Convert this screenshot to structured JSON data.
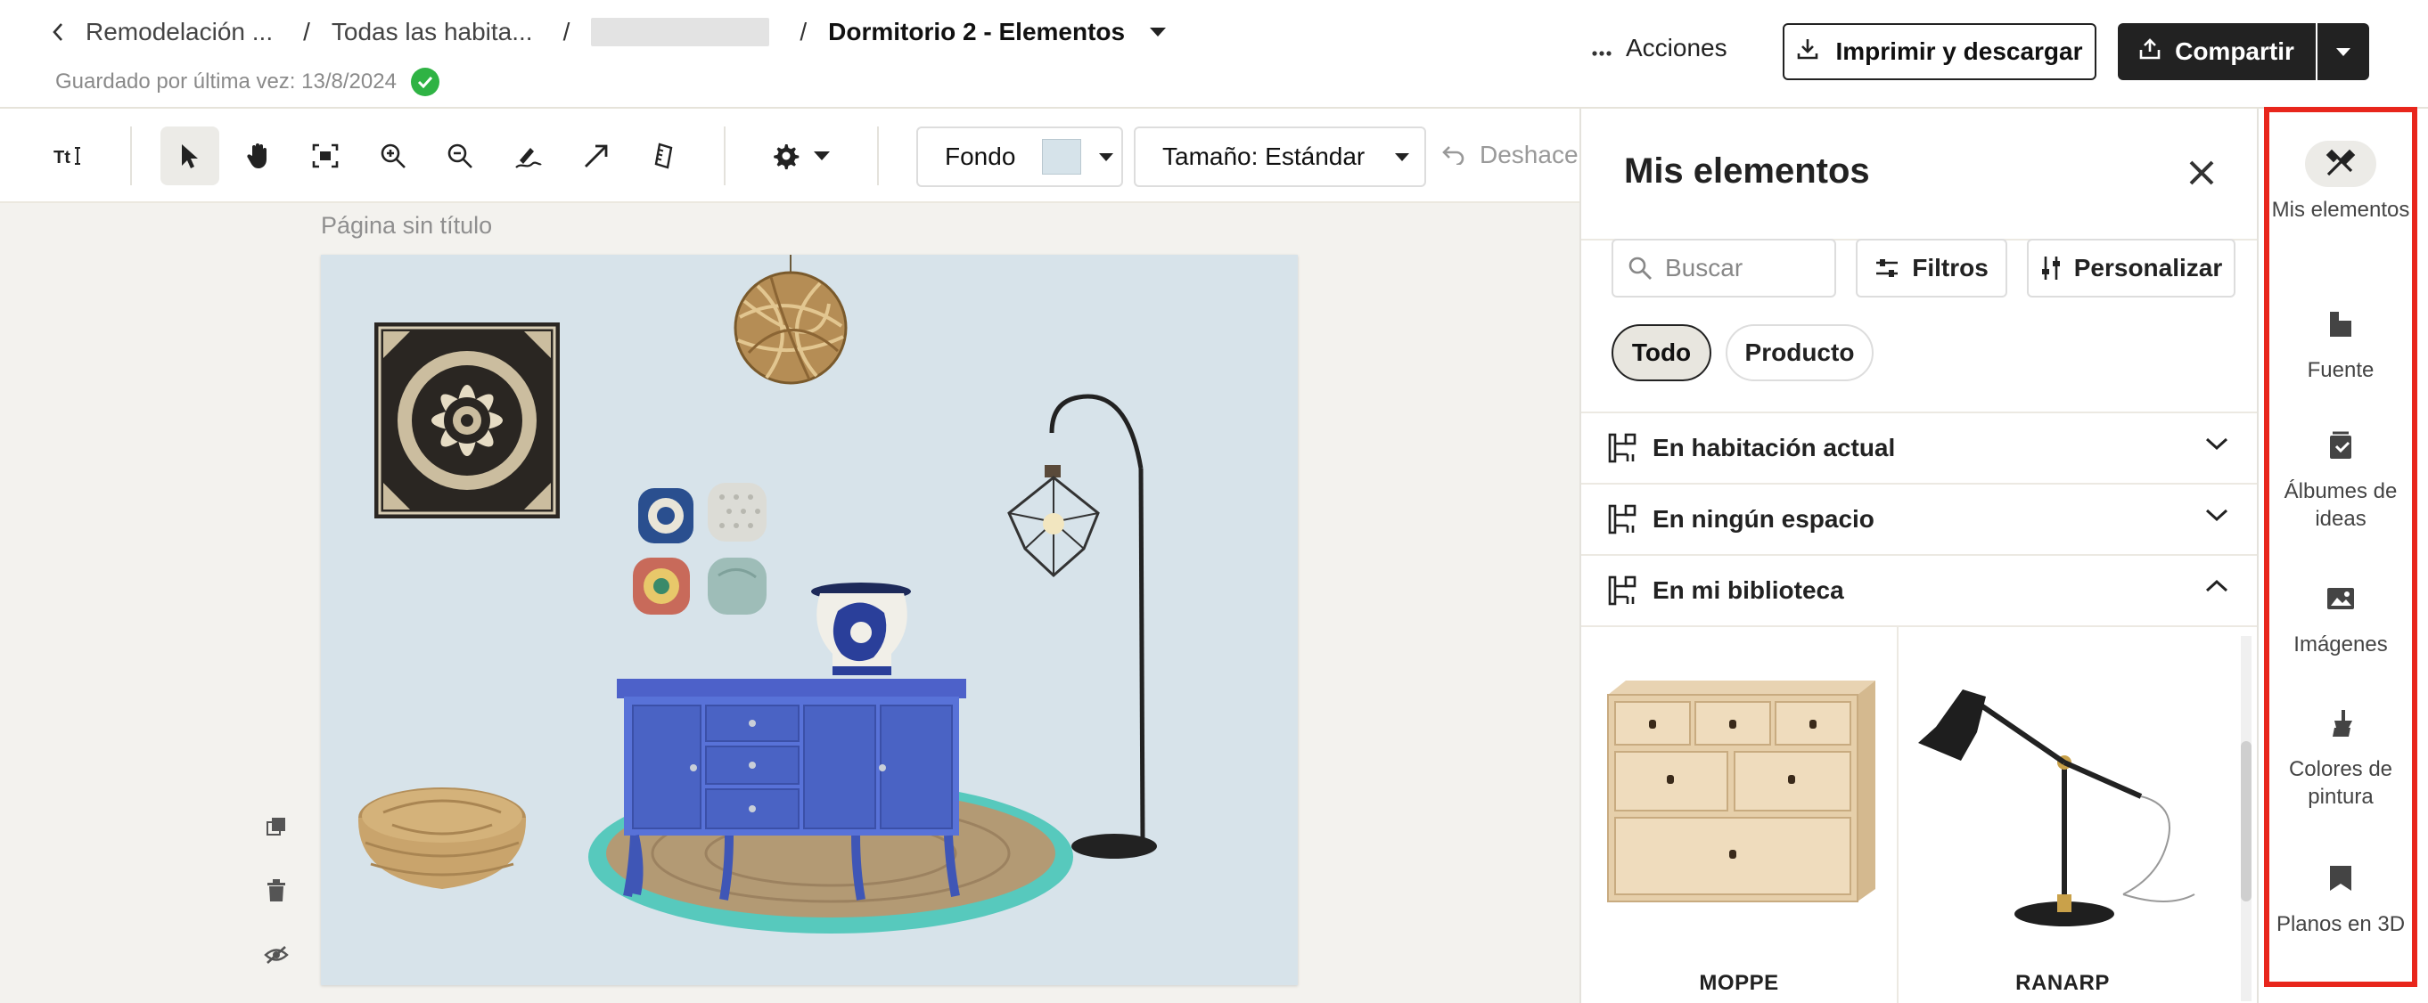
{
  "header": {
    "breadcrumb": [
      {
        "label": "Remodelación ..."
      },
      {
        "label": "Todas las habita..."
      },
      {
        "label": ""
      },
      {
        "label": "Dormitorio 2 - Elementos"
      }
    ],
    "separator": "/",
    "saved_text": "Guardado por última vez: 13/8/2024",
    "actions_label": "Acciones",
    "print_label": "Imprimir y descargar",
    "share_label": "Compartir"
  },
  "toolbar": {
    "tools": [
      "text-tool",
      "select-tool",
      "pan-tool",
      "fit-tool",
      "zoom-in",
      "zoom-out",
      "draw-tool",
      "arrow-tool",
      "ruler-tool",
      "settings"
    ],
    "active_tool": "select-tool",
    "background_label": "Fondo",
    "background_color": "#d6e3ea",
    "size_label": "Tamaño: Estándar",
    "undo_label": "Deshace"
  },
  "canvas": {
    "page_title": "Página sin título",
    "board_color": "#d7e3ea",
    "items": [
      "mandala-wall-art",
      "rattan-pendant-lamp",
      "floor-lamp",
      "pillows",
      "blue-vase",
      "blue-sideboard",
      "jute-rug",
      "jute-pouf"
    ]
  },
  "panel": {
    "title": "Mis elementos",
    "search_placeholder": "Buscar",
    "filters_label": "Filtros",
    "customize_label": "Personalizar",
    "chips": [
      {
        "label": "Todo",
        "active": true
      },
      {
        "label": "Producto",
        "active": false
      }
    ],
    "sections": [
      {
        "label": "En habitación actual",
        "expanded": false
      },
      {
        "label": "En ningún espacio",
        "expanded": false
      },
      {
        "label": "En mi biblioteca",
        "expanded": true
      }
    ],
    "products": [
      {
        "name": "MOPPE"
      },
      {
        "name": "RANARP"
      }
    ]
  },
  "rail": {
    "items": [
      {
        "label": "Mis elementos",
        "icon": "tools-icon",
        "active": true
      },
      {
        "label": "Fuente",
        "icon": "source-icon",
        "active": false
      },
      {
        "label": "Álbumes de ideas",
        "icon": "album-icon",
        "active": false
      },
      {
        "label": "Imágenes",
        "icon": "image-icon",
        "active": false
      },
      {
        "label": "Colores de pintura",
        "icon": "paint-icon",
        "active": false
      },
      {
        "label": "Planos en 3D",
        "icon": "plan-icon",
        "active": false
      }
    ],
    "highlight_color": "#e8261c"
  }
}
